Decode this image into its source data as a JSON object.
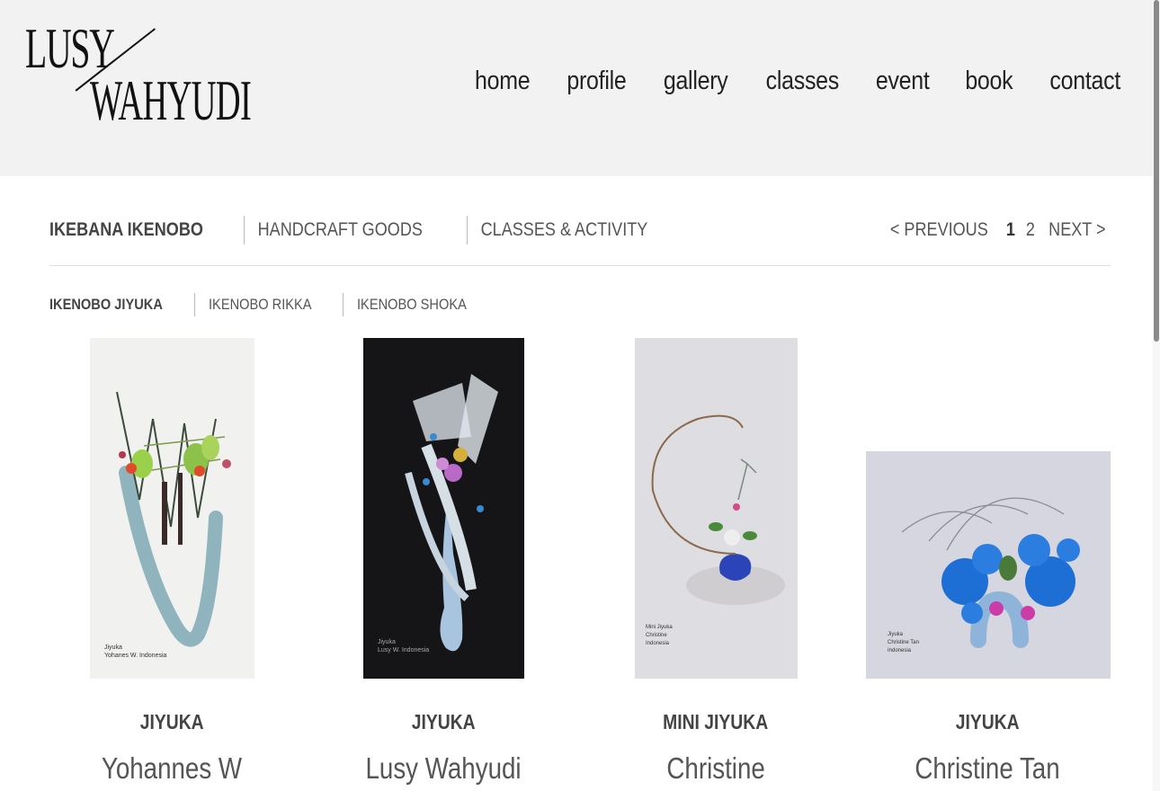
{
  "logo": {
    "line1": "LUSY",
    "line2": "WAHYUDI"
  },
  "nav": [
    "home",
    "profile",
    "gallery",
    "classes",
    "event",
    "book",
    "contact"
  ],
  "categories": [
    "IKEBANA IKENOBO",
    "HANDCRAFT GOODS",
    "CLASSES & ACTIVITY"
  ],
  "active_category": "IKEBANA IKENOBO",
  "pagination": {
    "previous": "< PREVIOUS",
    "pages": [
      "1",
      "2"
    ],
    "current": "1",
    "next": "NEXT >"
  },
  "subcategories": [
    "IKENOBO JIYUKA",
    "IKENOBO RIKKA",
    "IKENOBO SHOKA"
  ],
  "active_subcategory": "IKENOBO JIYUKA",
  "gallery": [
    {
      "type": "JIYUKA",
      "name": "Yohannes W",
      "photo_label": [
        "Jiyuka",
        "Yohanes W. Indonesia"
      ]
    },
    {
      "type": "JIYUKA",
      "name": "Lusy Wahyudi",
      "photo_label": [
        "Jiyuka",
        "Lusy W. Indonesia"
      ]
    },
    {
      "type": "MINI JIYUKA",
      "name": "Christine",
      "photo_label": [
        "Mini Jiyuka",
        "Christine",
        "Indonesia"
      ]
    },
    {
      "type": "JIYUKA",
      "name": "Christine Tan",
      "photo_label": [
        "Jiyuka",
        "Christine Tan",
        "Indonesia"
      ]
    }
  ],
  "colors": {
    "header_bg": "#f2f2f2",
    "page_bg": "#ffffff",
    "text": "#444444"
  }
}
